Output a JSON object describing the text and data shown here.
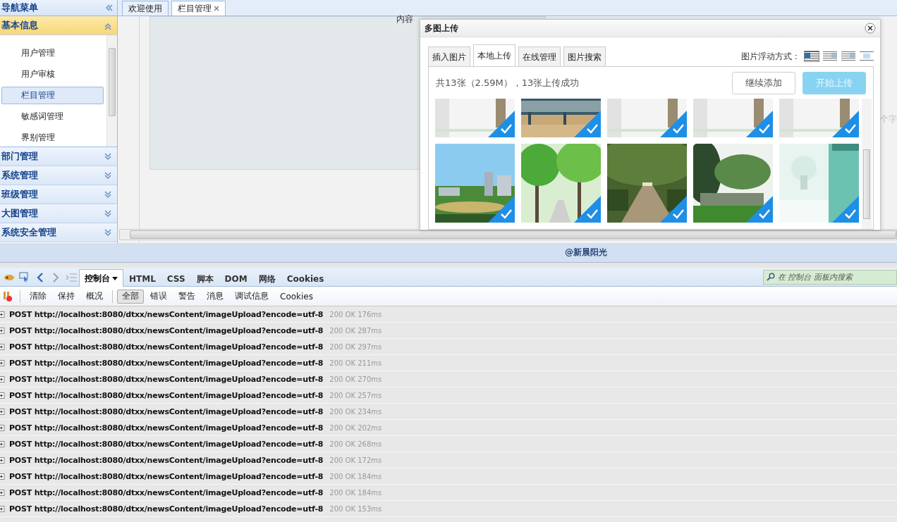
{
  "sidebar": {
    "title": "导航菜单",
    "sections": [
      {
        "label": "基本信息",
        "expanded": true,
        "items": [
          {
            "label": "用户管理",
            "selected": false
          },
          {
            "label": "用户审核",
            "selected": false
          },
          {
            "label": "栏目管理",
            "selected": true
          },
          {
            "label": "敏感词管理",
            "selected": false
          },
          {
            "label": "界别管理",
            "selected": false
          }
        ]
      },
      {
        "label": "部门管理",
        "expanded": false
      },
      {
        "label": "系统管理",
        "expanded": false
      },
      {
        "label": "班级管理",
        "expanded": false
      },
      {
        "label": "大图管理",
        "expanded": false
      },
      {
        "label": "系统安全管理",
        "expanded": false
      }
    ]
  },
  "tabs": [
    {
      "label": "欢迎使用",
      "selected": false,
      "closable": false
    },
    {
      "label": "栏目管理",
      "selected": true,
      "closable": true
    }
  ],
  "content": {
    "field_label": "内容",
    "hint": "个字"
  },
  "dialog": {
    "title": "多图上传",
    "tabs": [
      {
        "label": "插入图片",
        "selected": false
      },
      {
        "label": "本地上传",
        "selected": true
      },
      {
        "label": "在线管理",
        "selected": false
      },
      {
        "label": "图片搜索",
        "selected": false
      }
    ],
    "float_label": "图片浮动方式：",
    "float_options": [
      {
        "selected": true
      },
      {
        "selected": false
      },
      {
        "selected": false
      },
      {
        "selected": false
      }
    ],
    "summary": "共13张（2.59M），13张上传成功",
    "buttons": [
      {
        "label": "继续添加",
        "kind": "secondary"
      },
      {
        "label": "开始上传",
        "kind": "primary",
        "disabled": true
      }
    ],
    "thumbnails": [
      {
        "kind": "picture",
        "uploaded": true
      },
      {
        "kind": "picture",
        "uploaded": true
      },
      {
        "kind": "picture",
        "uploaded": true
      },
      {
        "kind": "picture",
        "uploaded": true
      },
      {
        "kind": "picture",
        "uploaded": true
      },
      {
        "kind": "picture",
        "uploaded": true
      },
      {
        "kind": "picture",
        "uploaded": true
      },
      {
        "kind": "picture",
        "uploaded": true
      },
      {
        "kind": "picture",
        "uploaded": true
      },
      {
        "kind": "picture",
        "uploaded": true
      }
    ]
  },
  "footer": {
    "text": "@新晨阳光"
  },
  "devtools": {
    "tabs": [
      {
        "label": "控制台",
        "selected": true,
        "menu": true
      },
      {
        "label": "HTML",
        "selected": false,
        "menu": false
      },
      {
        "label": "CSS",
        "selected": false,
        "menu": false
      },
      {
        "label": "脚本",
        "selected": false,
        "menu": false
      },
      {
        "label": "DOM",
        "selected": false,
        "menu": false
      },
      {
        "label": "网络",
        "selected": false,
        "menu": false
      },
      {
        "label": "Cookies",
        "selected": false,
        "menu": false
      }
    ],
    "search": {
      "placeholder": "在 控制台 面板内搜索"
    },
    "actions": [
      "清除",
      "保持",
      "概况"
    ],
    "filters": [
      {
        "label": "全部",
        "selected": true
      },
      {
        "label": "错误",
        "selected": false
      },
      {
        "label": "警告",
        "selected": false
      },
      {
        "label": "消息",
        "selected": false
      },
      {
        "label": "调试信息",
        "selected": false
      },
      {
        "label": "Cookies",
        "selected": false
      }
    ],
    "log": [
      {
        "method": "POST",
        "url": "http://localhost:8080/dtxx/newsContent/imageUpload?encode=utf-8",
        "status": "200 OK",
        "time": "176ms"
      },
      {
        "method": "POST",
        "url": "http://localhost:8080/dtxx/newsContent/imageUpload?encode=utf-8",
        "status": "200 OK",
        "time": "287ms"
      },
      {
        "method": "POST",
        "url": "http://localhost:8080/dtxx/newsContent/imageUpload?encode=utf-8",
        "status": "200 OK",
        "time": "297ms"
      },
      {
        "method": "POST",
        "url": "http://localhost:8080/dtxx/newsContent/imageUpload?encode=utf-8",
        "status": "200 OK",
        "time": "211ms"
      },
      {
        "method": "POST",
        "url": "http://localhost:8080/dtxx/newsContent/imageUpload?encode=utf-8",
        "status": "200 OK",
        "time": "270ms"
      },
      {
        "method": "POST",
        "url": "http://localhost:8080/dtxx/newsContent/imageUpload?encode=utf-8",
        "status": "200 OK",
        "time": "257ms"
      },
      {
        "method": "POST",
        "url": "http://localhost:8080/dtxx/newsContent/imageUpload?encode=utf-8",
        "status": "200 OK",
        "time": "234ms"
      },
      {
        "method": "POST",
        "url": "http://localhost:8080/dtxx/newsContent/imageUpload?encode=utf-8",
        "status": "200 OK",
        "time": "202ms"
      },
      {
        "method": "POST",
        "url": "http://localhost:8080/dtxx/newsContent/imageUpload?encode=utf-8",
        "status": "200 OK",
        "time": "268ms"
      },
      {
        "method": "POST",
        "url": "http://localhost:8080/dtxx/newsContent/imageUpload?encode=utf-8",
        "status": "200 OK",
        "time": "172ms"
      },
      {
        "method": "POST",
        "url": "http://localhost:8080/dtxx/newsContent/imageUpload?encode=utf-8",
        "status": "200 OK",
        "time": "184ms"
      },
      {
        "method": "POST",
        "url": "http://localhost:8080/dtxx/newsContent/imageUpload?encode=utf-8",
        "status": "200 OK",
        "time": "184ms"
      },
      {
        "method": "POST",
        "url": "http://localhost:8080/dtxx/newsContent/imageUpload?encode=utf-8",
        "status": "200 OK",
        "time": "153ms"
      }
    ]
  }
}
